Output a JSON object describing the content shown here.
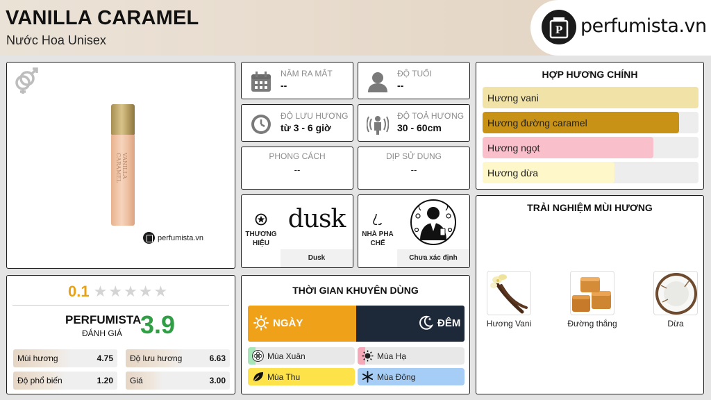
{
  "header": {
    "title": "VANILLA CARAMEL",
    "subtitle": "Nước Hoa Unisex",
    "logo_text": "perfumista.vn"
  },
  "product": {
    "bottle_label": "VANILLA CARAMEL",
    "watermark": "perfumista.vn",
    "gender_icon": "gender-unisex-icon"
  },
  "info": {
    "release": {
      "label": "NĂM RA MẮT",
      "value": "--",
      "icon": "calendar-icon"
    },
    "age": {
      "label": "ĐỘ TUỔI",
      "value": "--",
      "icon": "person-icon"
    },
    "longevity": {
      "label": "ĐỘ LƯU HƯƠNG",
      "value": "từ 3 - 6 giờ",
      "icon": "clock-icon"
    },
    "sillage": {
      "label": "ĐỘ TOẢ HƯƠNG",
      "value": "30 - 60cm",
      "icon": "diffusion-icon"
    },
    "style": {
      "label": "PHONG CÁCH",
      "value": "--"
    },
    "occasion": {
      "label": "DỊP SỬ DỤNG",
      "value": "--"
    }
  },
  "brand": {
    "label_line1": "THƯƠNG",
    "label_line2": "HIỆU",
    "logo_word": "dusk",
    "name": "Dusk"
  },
  "perfumer": {
    "label_line1": "NHÀ PHA",
    "label_line2": "CHẾ",
    "name": "Chưa xác định"
  },
  "accords": {
    "title": "HỢP HƯƠNG CHÍNH",
    "items": [
      {
        "label": "Hương vani",
        "percent": 100,
        "color": "#f1e3a8"
      },
      {
        "label": "Hương đường caramel",
        "percent": 91,
        "color": "#c89217"
      },
      {
        "label": "Hương ngọt",
        "percent": 79,
        "color": "#f9bfca"
      },
      {
        "label": "Hương dừa",
        "percent": 61,
        "color": "#fdf7c9"
      }
    ]
  },
  "experience": {
    "title": "TRẢI NGHIỆM MÙI HƯƠNG",
    "items": [
      {
        "label": "Hương Vani",
        "icon": "vanilla-icon"
      },
      {
        "label": "Đường thắng",
        "icon": "caramel-icon"
      },
      {
        "label": "Dừa",
        "icon": "coconut-icon"
      }
    ]
  },
  "rating": {
    "user_score": "0.1",
    "stars_filled": 0,
    "stars_total": 5,
    "brand_name": "PERFUMISTA",
    "brand_sub": "ĐÁNH GIÁ",
    "perfumista_score": "3.9",
    "metrics": [
      {
        "label": "Mùi hương",
        "value": "4.75",
        "fraction": 0.55
      },
      {
        "label": "Độ lưu hương",
        "value": "6.63",
        "fraction": 0.55
      },
      {
        "label": "Độ phổ biến",
        "value": "1.20",
        "fraction": 0.5
      },
      {
        "label": "Giá",
        "value": "3.00",
        "fraction": 0.35
      }
    ]
  },
  "time": {
    "title": "THỜI GIAN KHUYÊN DÙNG",
    "day": "NGÀY",
    "night": "ĐÊM",
    "day_color": "#f0a11a",
    "night_color": "#1d2838",
    "seasons": [
      {
        "label": "Mùa Xuân",
        "fill": 0.07,
        "color": "#a7e4b7",
        "icon": "flower-icon"
      },
      {
        "label": "Mùa Hạ",
        "fill": 0.07,
        "color": "#f5a9b8",
        "icon": "sun-icon"
      },
      {
        "label": "Mùa Thu",
        "fill": 1.0,
        "color": "#fde24a",
        "icon": "leaf-icon"
      },
      {
        "label": "Mùa Đông",
        "fill": 1.0,
        "color": "#a6cdf6",
        "icon": "snowflake-icon"
      }
    ]
  }
}
